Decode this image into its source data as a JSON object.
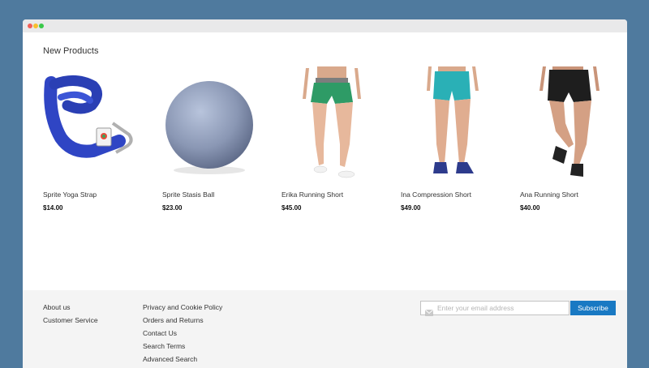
{
  "section": {
    "title": "New Products"
  },
  "products": [
    {
      "name": "Sprite Yoga Strap",
      "price": "$14.00",
      "image": "yoga-strap"
    },
    {
      "name": "Sprite Stasis Ball",
      "price": "$23.00",
      "image": "stasis-ball"
    },
    {
      "name": "Erika Running Short",
      "price": "$45.00",
      "image": "erika-running-short"
    },
    {
      "name": "Ina Compression Short",
      "price": "$49.00",
      "image": "ina-compression-short"
    },
    {
      "name": "Ana Running Short",
      "price": "$40.00",
      "image": "ana-running-short"
    }
  ],
  "footer": {
    "col1": [
      "About us",
      "Customer Service"
    ],
    "col2": [
      "Privacy and Cookie Policy",
      "Orders and Returns",
      "Contact Us",
      "Search Terms",
      "Advanced Search"
    ],
    "newsletter": {
      "placeholder": "Enter your email address",
      "button": "Subscribe"
    }
  },
  "colors": {
    "background": "#4f7a9e",
    "accent": "#1979c3",
    "footer": "#f4f4f4"
  }
}
